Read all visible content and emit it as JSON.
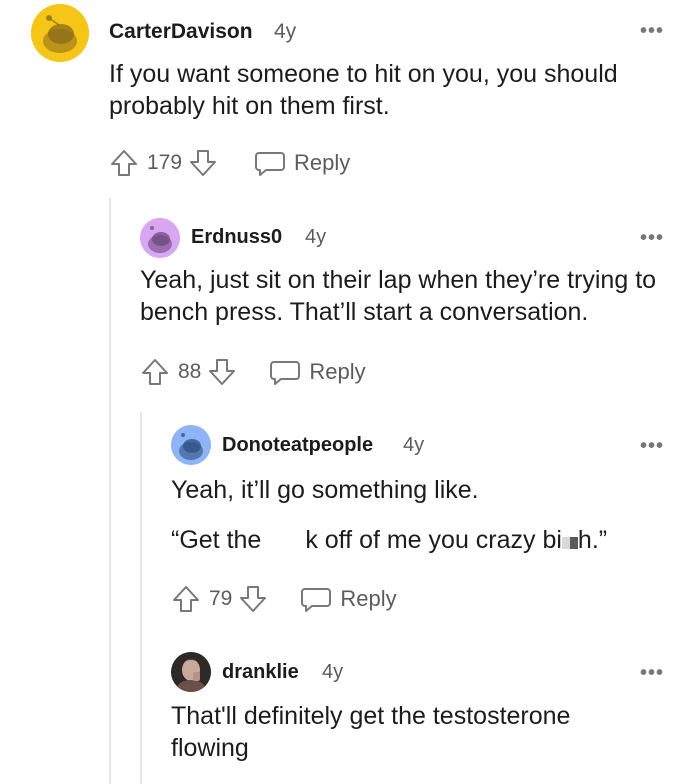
{
  "colors": {
    "text": "#1c1c1c",
    "meta": "#5c5c5c",
    "icon": "#787878",
    "thread_line": "#e5e5e5",
    "avatar_yellow": "#f5c518",
    "avatar_lilac": "#d9a6f2",
    "avatar_blue": "#8fb4f5"
  },
  "icons": {
    "upvote": "arrow-up-outline",
    "downvote": "arrow-down-outline",
    "reply": "speech-bubble-outline",
    "more": "horizontal-ellipsis"
  },
  "comments": [
    {
      "username": "CarterDavison",
      "age": "4y",
      "more": "•••",
      "body": [
        "If you want someone to hit on you, you should probably hit on them first."
      ],
      "score": "179",
      "reply_label": "Reply"
    },
    {
      "username": "Erdnuss0",
      "age": "4y",
      "more": "•••",
      "body": [
        "Yeah, just sit on their lap when they’re trying to bench press. That’ll start a conversation."
      ],
      "score": "88",
      "reply_label": "Reply"
    },
    {
      "username": "Donoteatpeople",
      "age": "4y",
      "more": "•••",
      "body": [
        "Yeah, it’ll go something like."
      ],
      "quote_before": "“Get the",
      "quote_after": "k off of me you crazy bi",
      "quote_end": "h.”",
      "score": "79",
      "reply_label": "Reply"
    },
    {
      "username": "dranklie",
      "age": "4y",
      "more": "•••",
      "body": [
        "That'll definitely get the testosterone flowing"
      ]
    }
  ]
}
